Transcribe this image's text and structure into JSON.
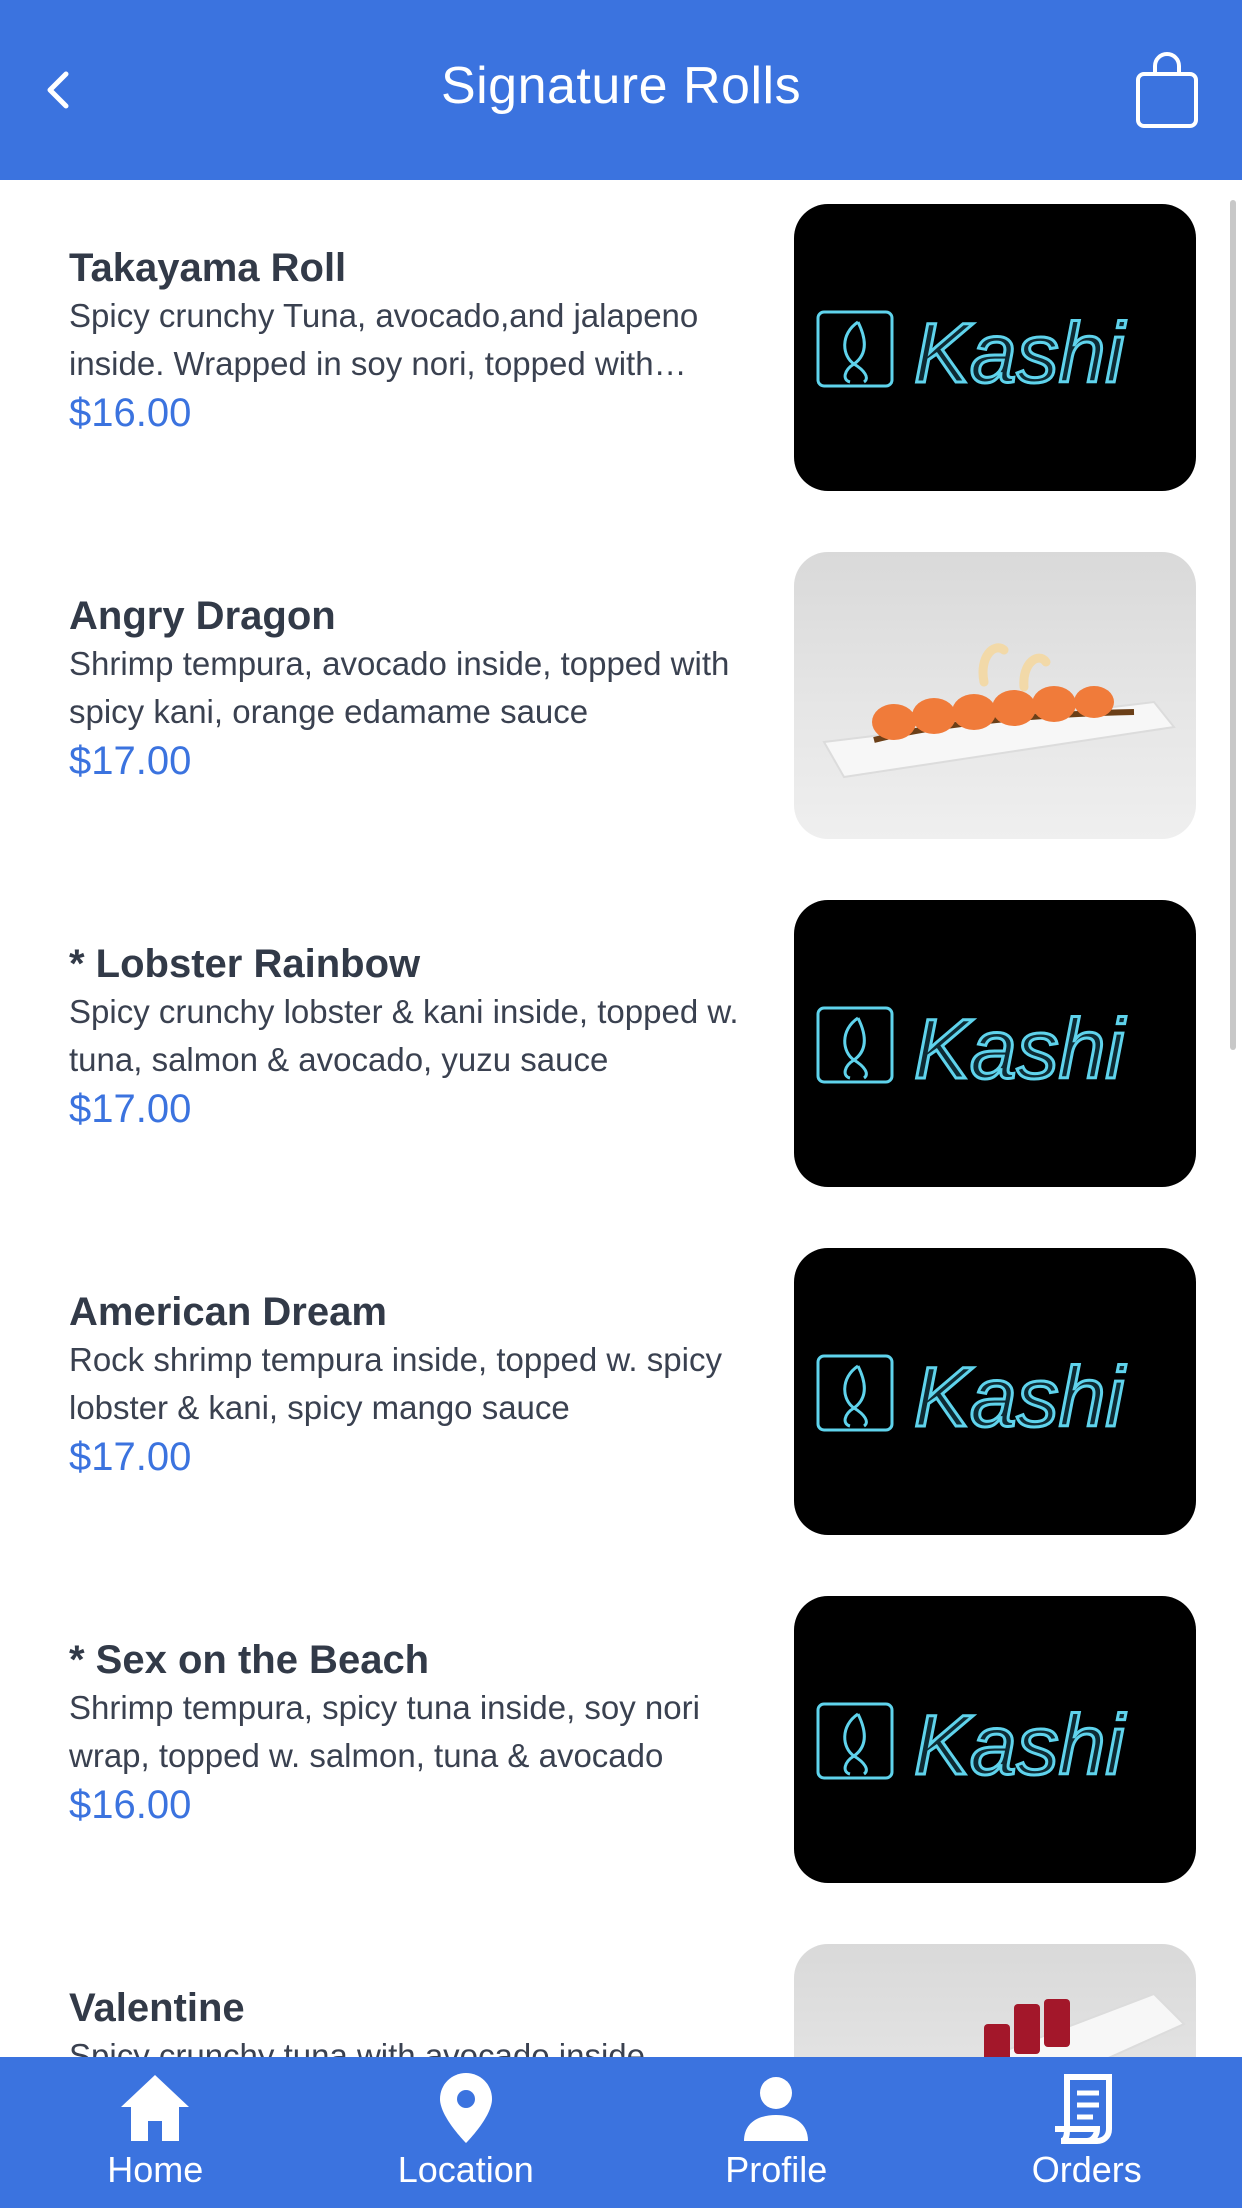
{
  "header": {
    "title": "Signature Rolls",
    "back_icon": "chevron-left-icon",
    "cart_icon": "shopping-bag-icon"
  },
  "logo_text": "Kashi",
  "items": [
    {
      "name": "Takayama Roll",
      "description": "Spicy crunchy Tuna, avocado,and jalapeno inside. Wrapped in soy nori, topped with salmon",
      "price": "$16.00",
      "image": "kashi-logo"
    },
    {
      "name": "Angry Dragon",
      "description": "Shrimp tempura, avocado inside, topped with spicy kani, orange edamame sauce",
      "price": "$17.00",
      "image": "sushi-photo"
    },
    {
      "name": "* Lobster Rainbow",
      "description": "Spicy crunchy lobster & kani inside, topped w. tuna, salmon & avocado, yuzu sauce",
      "price": "$17.00",
      "image": "kashi-logo"
    },
    {
      "name": "American Dream",
      "description": "Rock shrimp tempura inside, topped w. spicy lobster & kani, spicy mango sauce",
      "price": "$17.00",
      "image": "kashi-logo"
    },
    {
      "name": "* Sex on the Beach",
      "description": "Shrimp tempura, spicy tuna inside, soy nori wrap, topped w. salmon, tuna & avocado",
      "price": "$16.00",
      "image": "kashi-logo"
    },
    {
      "name": "Valentine",
      "description": "Spicy crunchy tuna with avocado inside,",
      "price": "",
      "image": "sushi-photo"
    }
  ],
  "nav": [
    {
      "label": "Home",
      "icon": "home-icon"
    },
    {
      "label": "Location",
      "icon": "location-pin-icon"
    },
    {
      "label": "Profile",
      "icon": "person-icon"
    },
    {
      "label": "Orders",
      "icon": "receipt-icon"
    }
  ],
  "colors": {
    "accent": "#3b73df",
    "title_text": "#323a48",
    "price_text": "#3b73df",
    "logo_glow": "#5fd3ec"
  }
}
